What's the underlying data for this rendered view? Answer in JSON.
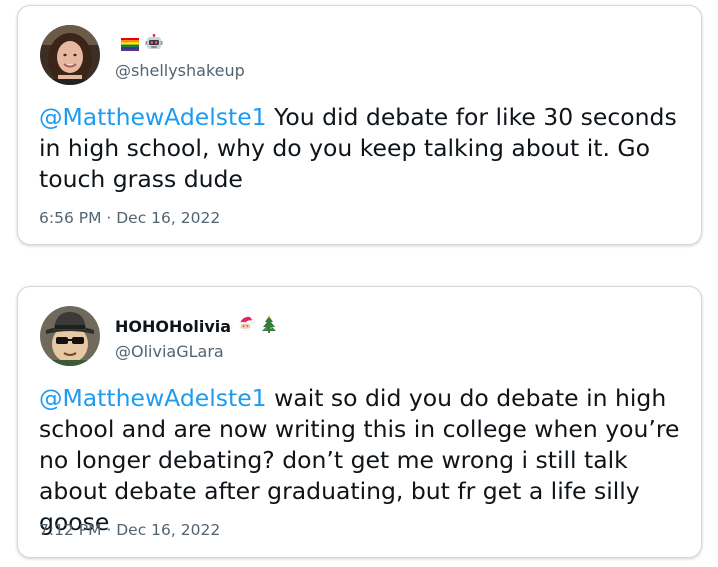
{
  "tweets": [
    {
      "display_name": "",
      "name_emojis": [
        "rainbow-flag-icon",
        "robot-face-icon"
      ],
      "handle": "@shellyshakeup",
      "mention": "@MatthewAdelste1",
      "body": " You did debate for like 30 seconds in high school, why do you keep talking about it. Go touch grass dude",
      "timestamp": "6:56 PM · Dec 16, 2022"
    },
    {
      "display_name": "HOHOHolivia",
      "name_emojis": [
        "santa-face-icon",
        "christmas-tree-icon"
      ],
      "handle": "@OliviaGLara",
      "mention": "@MatthewAdelste1",
      "body": " wait so did you do debate in high school and are now writing this in college when you’re no longer debating? don’t get me wrong i still talk about debate after graduating, but fr get a life silly goose",
      "timestamp": "7:12 PM · Dec 16, 2022"
    }
  ],
  "colors": {
    "mention": "#1d9bf0",
    "secondary_text": "#536471",
    "primary_text": "#0f1419",
    "card_border": "#cfd9de"
  }
}
